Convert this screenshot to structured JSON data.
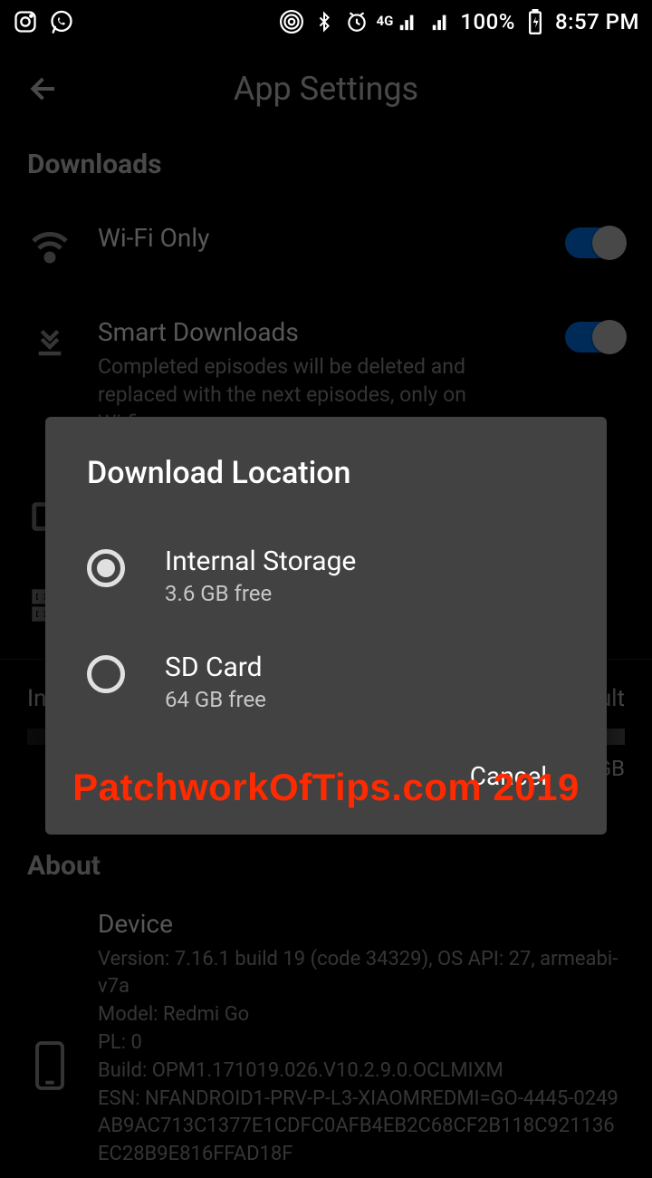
{
  "status": {
    "battery": "100%",
    "time": "8:57 PM",
    "net_label": "4G"
  },
  "header": {
    "title": "App Settings"
  },
  "downloads": {
    "section_title": "Downloads",
    "wifi": {
      "label": "Wi-Fi Only"
    },
    "smart": {
      "label": "Smart Downloads",
      "sub": "Completed episodes will be deleted and replaced with the next episodes, only on Wi-fi."
    },
    "storage": {
      "left_label": "In",
      "right_label": "ult",
      "gb_suffix": "GB"
    }
  },
  "dialog": {
    "title": "Download Location",
    "options": [
      {
        "label": "Internal Storage",
        "sub": "3.6 GB free",
        "selected": true
      },
      {
        "label": "SD Card",
        "sub": "64 GB free",
        "selected": false
      }
    ],
    "cancel": "Cancel"
  },
  "about": {
    "section_title": "About",
    "device_title": "Device",
    "lines": [
      "Version: 7.16.1 build 19 (code 34329), OS API: 27, armeabi-v7a",
      "Model: Redmi Go",
      "PL: 0",
      "Build: OPM1.171019.026.V10.2.9.0.OCLMIXM",
      "ESN: NFANDROID1-PRV-P-L3-XIAOMREDMI=GO-4445-0249AB9AC713C1377E1CDFC0AFB4EB2C68CF2B118C921136EC28B9E816FFAD18F"
    ]
  },
  "watermark": "PatchworkOfTips.com 2019"
}
